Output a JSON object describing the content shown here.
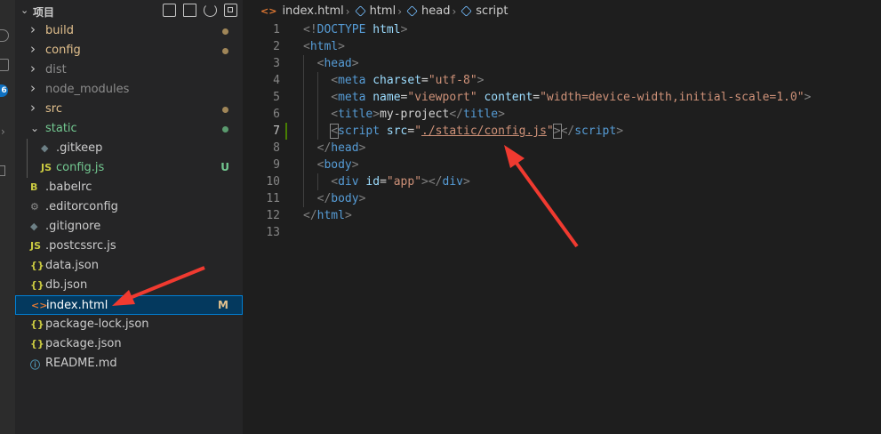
{
  "explorer": {
    "title": "项目",
    "items": [
      {
        "label": "build",
        "type": "folder",
        "open": false,
        "depth": 0,
        "color": "#e2c08d",
        "status": "dot",
        "status_color": "#a08658"
      },
      {
        "label": "config",
        "type": "folder",
        "open": false,
        "depth": 0,
        "color": "#e2c08d",
        "status": "dot",
        "status_color": "#a08658"
      },
      {
        "label": "dist",
        "type": "folder",
        "open": false,
        "depth": 0,
        "color": "#8c8c8c"
      },
      {
        "label": "node_modules",
        "type": "folder",
        "open": false,
        "depth": 0,
        "color": "#8c8c8c"
      },
      {
        "label": "src",
        "type": "folder",
        "open": false,
        "depth": 0,
        "color": "#e2c08d",
        "status": "dot",
        "status_color": "#a08658"
      },
      {
        "label": "static",
        "type": "folder",
        "open": true,
        "depth": 0,
        "color": "#73c991",
        "status": "dot",
        "status_color": "#5a9a6e"
      },
      {
        "label": ".gitkeep",
        "type": "file",
        "icon": "◆",
        "icon_color": "#6d8086",
        "depth": 1,
        "color": "#cccccc"
      },
      {
        "label": "config.js",
        "type": "file",
        "icon": "JS",
        "icon_color": "#cbcb41",
        "depth": 1,
        "color": "#73c991",
        "status": "badge",
        "badge": "U",
        "badge_color": "#73c991"
      },
      {
        "label": ".babelrc",
        "type": "file",
        "icon": "B",
        "icon_color": "#cbcb41",
        "depth": 0,
        "color": "#cccccc"
      },
      {
        "label": ".editorconfig",
        "type": "file",
        "icon": "⚙",
        "icon_color": "#8c8c8c",
        "depth": 0,
        "color": "#cccccc"
      },
      {
        "label": ".gitignore",
        "type": "file",
        "icon": "◆",
        "icon_color": "#6d8086",
        "depth": 0,
        "color": "#cccccc"
      },
      {
        "label": ".postcssrc.js",
        "type": "file",
        "icon": "JS",
        "icon_color": "#cbcb41",
        "depth": 0,
        "color": "#cccccc"
      },
      {
        "label": "data.json",
        "type": "file",
        "icon": "{}",
        "icon_color": "#cbcb41",
        "depth": 0,
        "color": "#cccccc"
      },
      {
        "label": "db.json",
        "type": "file",
        "icon": "{}",
        "icon_color": "#cbcb41",
        "depth": 0,
        "color": "#cccccc"
      },
      {
        "label": "index.html",
        "type": "file",
        "icon": "<>",
        "icon_color": "#e37933",
        "depth": 0,
        "color": "#e2c08d",
        "selected": true,
        "status": "badge",
        "badge": "M",
        "badge_color": "#e2c08d"
      },
      {
        "label": "package-lock.json",
        "type": "file",
        "icon": "{}",
        "icon_color": "#cbcb41",
        "depth": 0,
        "color": "#cccccc"
      },
      {
        "label": "package.json",
        "type": "file",
        "icon": "{}",
        "icon_color": "#cbcb41",
        "depth": 0,
        "color": "#cccccc"
      },
      {
        "label": "README.md",
        "type": "file",
        "icon": "ⓘ",
        "icon_color": "#519aba",
        "depth": 0,
        "color": "#cccccc"
      }
    ]
  },
  "activity_bar": {
    "badge": "6"
  },
  "breadcrumbs": {
    "file": "index.html",
    "parts": [
      "html",
      "head",
      "script"
    ],
    "sep": "›"
  },
  "code": {
    "active_line": 7,
    "lines": [
      {
        "n": "1",
        "indent": 0,
        "tokens": [
          [
            "ang",
            "<!"
          ],
          [
            "tag",
            "DOCTYPE"
          ],
          [
            "txt",
            " "
          ],
          [
            "attr",
            "html"
          ],
          [
            "ang",
            ">"
          ]
        ]
      },
      {
        "n": "2",
        "indent": 0,
        "tokens": [
          [
            "ang",
            "<"
          ],
          [
            "tag",
            "html"
          ],
          [
            "ang",
            ">"
          ]
        ]
      },
      {
        "n": "3",
        "indent": 1,
        "tokens": [
          [
            "ang",
            "<"
          ],
          [
            "tag",
            "head"
          ],
          [
            "ang",
            ">"
          ]
        ]
      },
      {
        "n": "4",
        "indent": 2,
        "tokens": [
          [
            "ang",
            "<"
          ],
          [
            "tag",
            "meta"
          ],
          [
            "txt",
            " "
          ],
          [
            "attr",
            "charset"
          ],
          [
            "txt",
            "="
          ],
          [
            "str",
            "\"utf-8\""
          ],
          [
            "ang",
            ">"
          ]
        ]
      },
      {
        "n": "5",
        "indent": 2,
        "tokens": [
          [
            "ang",
            "<"
          ],
          [
            "tag",
            "meta"
          ],
          [
            "txt",
            " "
          ],
          [
            "attr",
            "name"
          ],
          [
            "txt",
            "="
          ],
          [
            "str",
            "\"viewport\""
          ],
          [
            "txt",
            " "
          ],
          [
            "attr",
            "content"
          ],
          [
            "txt",
            "="
          ],
          [
            "str",
            "\"width=device-width,initial-scale=1.0\""
          ],
          [
            "ang",
            ">"
          ]
        ]
      },
      {
        "n": "6",
        "indent": 2,
        "tokens": [
          [
            "ang",
            "<"
          ],
          [
            "tag",
            "title"
          ],
          [
            "ang",
            ">"
          ],
          [
            "txt",
            "my-project"
          ],
          [
            "ang",
            "</"
          ],
          [
            "tag",
            "title"
          ],
          [
            "ang",
            ">"
          ]
        ]
      },
      {
        "n": "7",
        "indent": 2,
        "tokens": [
          [
            "angb",
            "<"
          ],
          [
            "tag",
            "script"
          ],
          [
            "txt",
            " "
          ],
          [
            "attr",
            "src"
          ],
          [
            "txt",
            "="
          ],
          [
            "str",
            "\""
          ],
          [
            "strl",
            "./static/config.js"
          ],
          [
            "str",
            "\""
          ],
          [
            "angb",
            ">"
          ],
          [
            "ang",
            "</"
          ],
          [
            "tag",
            "script"
          ],
          [
            "ang",
            ">"
          ]
        ]
      },
      {
        "n": "8",
        "indent": 1,
        "tokens": [
          [
            "ang",
            "</"
          ],
          [
            "tag",
            "head"
          ],
          [
            "ang",
            ">"
          ]
        ]
      },
      {
        "n": "9",
        "indent": 1,
        "tokens": [
          [
            "ang",
            "<"
          ],
          [
            "tag",
            "body"
          ],
          [
            "ang",
            ">"
          ]
        ]
      },
      {
        "n": "10",
        "indent": 2,
        "tokens": [
          [
            "ang",
            "<"
          ],
          [
            "tag",
            "div"
          ],
          [
            "txt",
            " "
          ],
          [
            "attr",
            "id"
          ],
          [
            "txt",
            "="
          ],
          [
            "str",
            "\"app\""
          ],
          [
            "ang",
            "></"
          ],
          [
            "tag",
            "div"
          ],
          [
            "ang",
            ">"
          ]
        ]
      },
      {
        "n": "11",
        "indent": 1,
        "tokens": [
          [
            "ang",
            "</"
          ],
          [
            "tag",
            "body"
          ],
          [
            "ang",
            ">"
          ]
        ]
      },
      {
        "n": "12",
        "indent": 0,
        "tokens": [
          [
            "ang",
            "</"
          ],
          [
            "tag",
            "html"
          ],
          [
            "ang",
            ">"
          ]
        ]
      },
      {
        "n": "13",
        "indent": 0,
        "tokens": []
      }
    ]
  },
  "colors": {
    "annotation_arrow": "#f03a30",
    "selection_bg": "#04395e",
    "selection_border": "#007fd4"
  }
}
